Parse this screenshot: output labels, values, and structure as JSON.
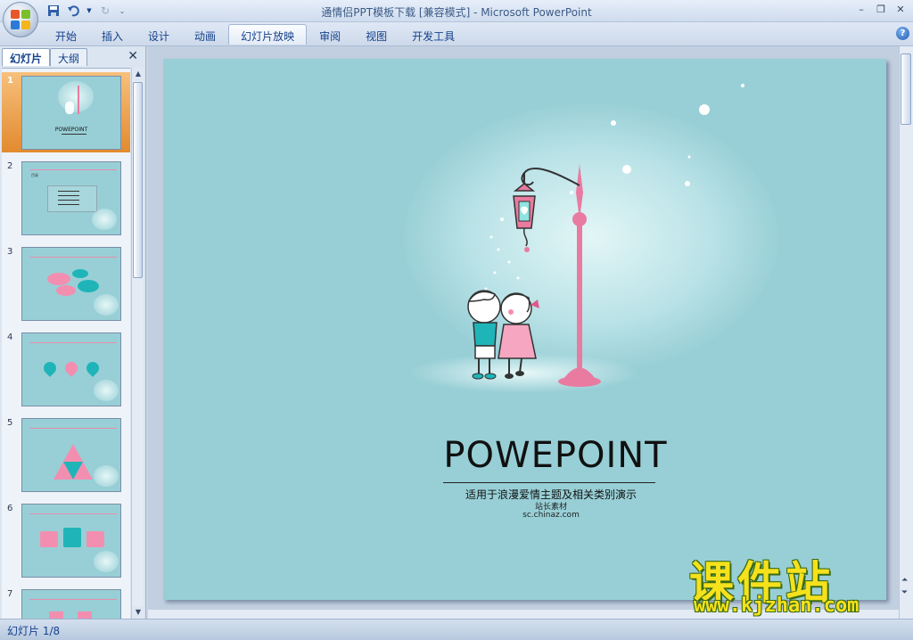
{
  "window": {
    "title": "通情侣PPT模板下载 [兼容模式] - Microsoft PowerPoint"
  },
  "ribbon": {
    "tabs": [
      "开始",
      "插入",
      "设计",
      "动画",
      "幻灯片放映",
      "审阅",
      "视图",
      "开发工具"
    ],
    "active_tab": "幻灯片放映"
  },
  "panel": {
    "tab_slides": "幻灯片",
    "tab_outline": "大纲",
    "slides": [
      {
        "num": "1",
        "label": "POWEPOINT"
      },
      {
        "num": "2",
        "label": "目录"
      },
      {
        "num": "3",
        "label": ""
      },
      {
        "num": "4",
        "label": ""
      },
      {
        "num": "5",
        "label": ""
      },
      {
        "num": "6",
        "label": ""
      },
      {
        "num": "7",
        "label": ""
      }
    ],
    "selected": 1
  },
  "slide": {
    "title": "POWEPOINT",
    "subtitle": "适用于浪漫爱情主题及相关类别演示",
    "source": "站长素材",
    "url": "sc.chinaz.com",
    "colors": {
      "background": "#98cfd6",
      "lamp": "#e97ba0"
    }
  },
  "status": {
    "slide_count": "幻灯片 1/8"
  },
  "watermark": {
    "title": "课件站",
    "url": "www.kjzhan.com"
  }
}
